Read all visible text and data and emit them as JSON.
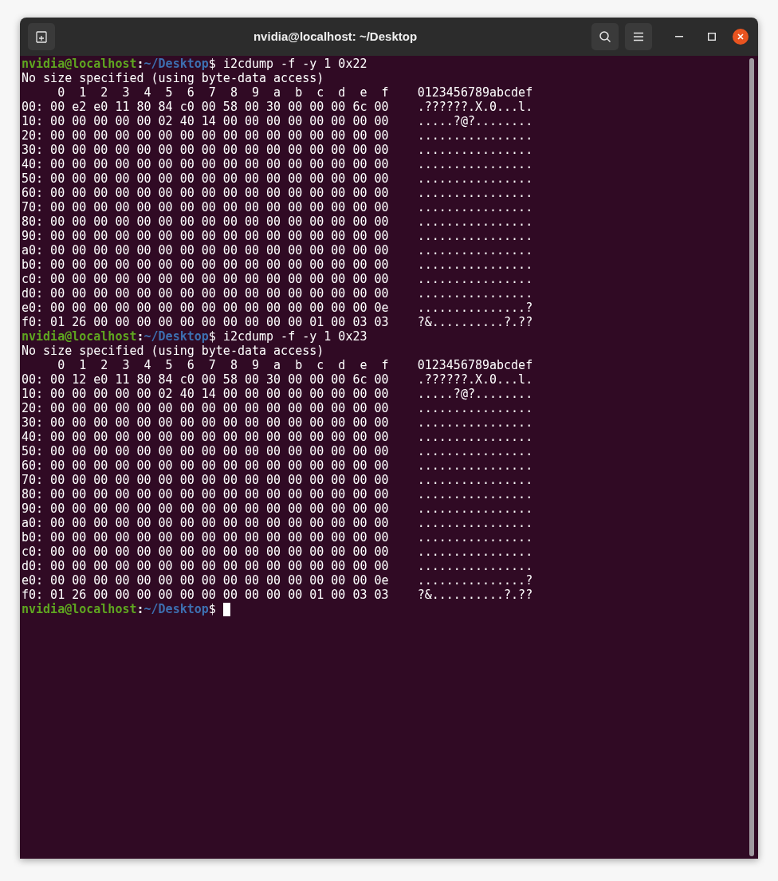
{
  "window": {
    "title": "nvidia@localhost: ~/Desktop"
  },
  "lines": [
    {
      "kind": "prompt",
      "user_host": "nvidia@localhost",
      "colon": ":",
      "path": "~/Desktop",
      "symbol": "$",
      "command": "i2cdump -f -y 1 0x22",
      "cursor": false
    },
    {
      "kind": "output",
      "text": "No size specified (using byte-data access)"
    },
    {
      "kind": "output",
      "text": "     0  1  2  3  4  5  6  7  8  9  a  b  c  d  e  f    0123456789abcdef"
    },
    {
      "kind": "output",
      "text": "00: 00 e2 e0 11 80 84 c0 00 58 00 30 00 00 00 6c 00    .??????.X.0...l."
    },
    {
      "kind": "output",
      "text": "10: 00 00 00 00 00 02 40 14 00 00 00 00 00 00 00 00    .....?@?........"
    },
    {
      "kind": "output",
      "text": "20: 00 00 00 00 00 00 00 00 00 00 00 00 00 00 00 00    ................"
    },
    {
      "kind": "output",
      "text": "30: 00 00 00 00 00 00 00 00 00 00 00 00 00 00 00 00    ................"
    },
    {
      "kind": "output",
      "text": "40: 00 00 00 00 00 00 00 00 00 00 00 00 00 00 00 00    ................"
    },
    {
      "kind": "output",
      "text": "50: 00 00 00 00 00 00 00 00 00 00 00 00 00 00 00 00    ................"
    },
    {
      "kind": "output",
      "text": "60: 00 00 00 00 00 00 00 00 00 00 00 00 00 00 00 00    ................"
    },
    {
      "kind": "output",
      "text": "70: 00 00 00 00 00 00 00 00 00 00 00 00 00 00 00 00    ................"
    },
    {
      "kind": "output",
      "text": "80: 00 00 00 00 00 00 00 00 00 00 00 00 00 00 00 00    ................"
    },
    {
      "kind": "output",
      "text": "90: 00 00 00 00 00 00 00 00 00 00 00 00 00 00 00 00    ................"
    },
    {
      "kind": "output",
      "text": "a0: 00 00 00 00 00 00 00 00 00 00 00 00 00 00 00 00    ................"
    },
    {
      "kind": "output",
      "text": "b0: 00 00 00 00 00 00 00 00 00 00 00 00 00 00 00 00    ................"
    },
    {
      "kind": "output",
      "text": "c0: 00 00 00 00 00 00 00 00 00 00 00 00 00 00 00 00    ................"
    },
    {
      "kind": "output",
      "text": "d0: 00 00 00 00 00 00 00 00 00 00 00 00 00 00 00 00    ................"
    },
    {
      "kind": "output",
      "text": "e0: 00 00 00 00 00 00 00 00 00 00 00 00 00 00 00 0e    ...............?"
    },
    {
      "kind": "output",
      "text": "f0: 01 26 00 00 00 00 00 00 00 00 00 00 01 00 03 03    ?&..........?.??"
    },
    {
      "kind": "prompt",
      "user_host": "nvidia@localhost",
      "colon": ":",
      "path": "~/Desktop",
      "symbol": "$",
      "command": "i2cdump -f -y 1 0x23",
      "cursor": false
    },
    {
      "kind": "output",
      "text": "No size specified (using byte-data access)"
    },
    {
      "kind": "output",
      "text": "     0  1  2  3  4  5  6  7  8  9  a  b  c  d  e  f    0123456789abcdef"
    },
    {
      "kind": "output",
      "text": "00: 00 12 e0 11 80 84 c0 00 58 00 30 00 00 00 6c 00    .??????.X.0...l."
    },
    {
      "kind": "output",
      "text": "10: 00 00 00 00 00 02 40 14 00 00 00 00 00 00 00 00    .....?@?........"
    },
    {
      "kind": "output",
      "text": "20: 00 00 00 00 00 00 00 00 00 00 00 00 00 00 00 00    ................"
    },
    {
      "kind": "output",
      "text": "30: 00 00 00 00 00 00 00 00 00 00 00 00 00 00 00 00    ................"
    },
    {
      "kind": "output",
      "text": "40: 00 00 00 00 00 00 00 00 00 00 00 00 00 00 00 00    ................"
    },
    {
      "kind": "output",
      "text": "50: 00 00 00 00 00 00 00 00 00 00 00 00 00 00 00 00    ................"
    },
    {
      "kind": "output",
      "text": "60: 00 00 00 00 00 00 00 00 00 00 00 00 00 00 00 00    ................"
    },
    {
      "kind": "output",
      "text": "70: 00 00 00 00 00 00 00 00 00 00 00 00 00 00 00 00    ................"
    },
    {
      "kind": "output",
      "text": "80: 00 00 00 00 00 00 00 00 00 00 00 00 00 00 00 00    ................"
    },
    {
      "kind": "output",
      "text": "90: 00 00 00 00 00 00 00 00 00 00 00 00 00 00 00 00    ................"
    },
    {
      "kind": "output",
      "text": "a0: 00 00 00 00 00 00 00 00 00 00 00 00 00 00 00 00    ................"
    },
    {
      "kind": "output",
      "text": "b0: 00 00 00 00 00 00 00 00 00 00 00 00 00 00 00 00    ................"
    },
    {
      "kind": "output",
      "text": "c0: 00 00 00 00 00 00 00 00 00 00 00 00 00 00 00 00    ................"
    },
    {
      "kind": "output",
      "text": "d0: 00 00 00 00 00 00 00 00 00 00 00 00 00 00 00 00    ................"
    },
    {
      "kind": "output",
      "text": "e0: 00 00 00 00 00 00 00 00 00 00 00 00 00 00 00 0e    ...............?"
    },
    {
      "kind": "output",
      "text": "f0: 01 26 00 00 00 00 00 00 00 00 00 00 01 00 03 03    ?&..........?.??"
    },
    {
      "kind": "prompt",
      "user_host": "nvidia@localhost",
      "colon": ":",
      "path": "~/Desktop",
      "symbol": "$",
      "cursor": true
    }
  ]
}
